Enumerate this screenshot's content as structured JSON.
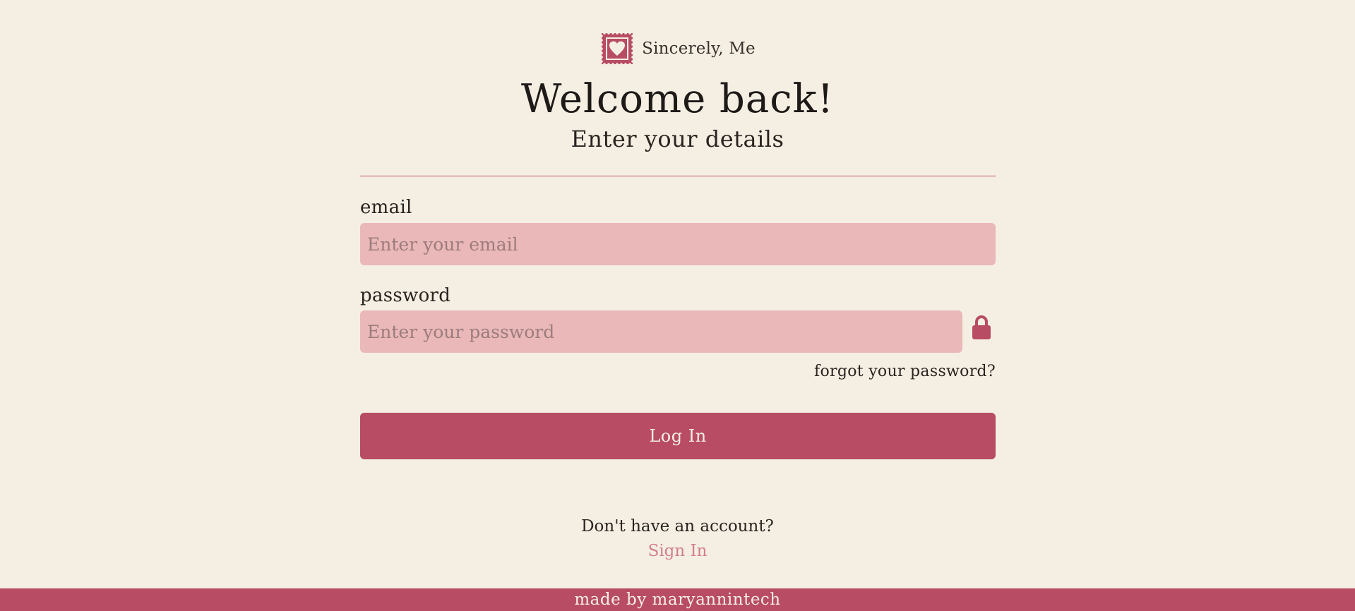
{
  "brand": {
    "name": "Sincerely, Me",
    "logo_icon": "heart-stamp-icon"
  },
  "header": {
    "title": "Welcome back!",
    "subtitle": "Enter your details"
  },
  "form": {
    "email_label": "email",
    "email_placeholder": "Enter your email",
    "email_value": "",
    "password_label": "password",
    "password_placeholder": "Enter your password",
    "password_value": "",
    "password_toggle_icon": "lock-icon",
    "forgot_password": "forgot your password?",
    "login_button": "Log In"
  },
  "signup": {
    "prompt": "Don't have an account?",
    "link": "Sign In"
  },
  "footer": {
    "text": "made by maryannintech"
  },
  "colors": {
    "background": "#f5efe3",
    "accent": "#b84c64",
    "input_fill": "#eab8b8",
    "link": "#d27e8e"
  }
}
